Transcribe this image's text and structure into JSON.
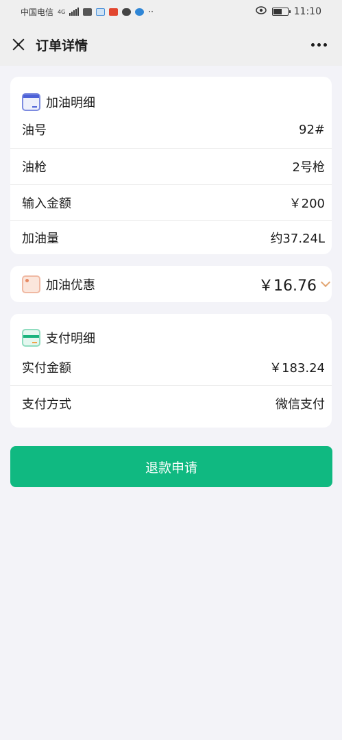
{
  "status_bar": {
    "carrier": "中国电信",
    "network": "4G",
    "time": "11:10"
  },
  "navbar": {
    "title": "订单详情"
  },
  "fuel_details": {
    "title": "加油明细",
    "icon": "fuel-detail-icon",
    "rows": [
      {
        "label": "油号",
        "value": "92#"
      },
      {
        "label": "油枪",
        "value": "2号枪"
      },
      {
        "label": "输入金额",
        "value": "￥200"
      },
      {
        "label": "加油量",
        "value": "约37.24L"
      }
    ]
  },
  "discount": {
    "title": "加油优惠",
    "icon": "coupon-icon",
    "amount": "￥16.76"
  },
  "payment_details": {
    "title": "支付明细",
    "icon": "payment-card-icon",
    "rows": [
      {
        "label": "实付金额",
        "value": "￥183.24"
      },
      {
        "label": "支付方式",
        "value": "微信支付"
      }
    ]
  },
  "refund_button": {
    "label": "退款申请",
    "color": "#10b981"
  }
}
